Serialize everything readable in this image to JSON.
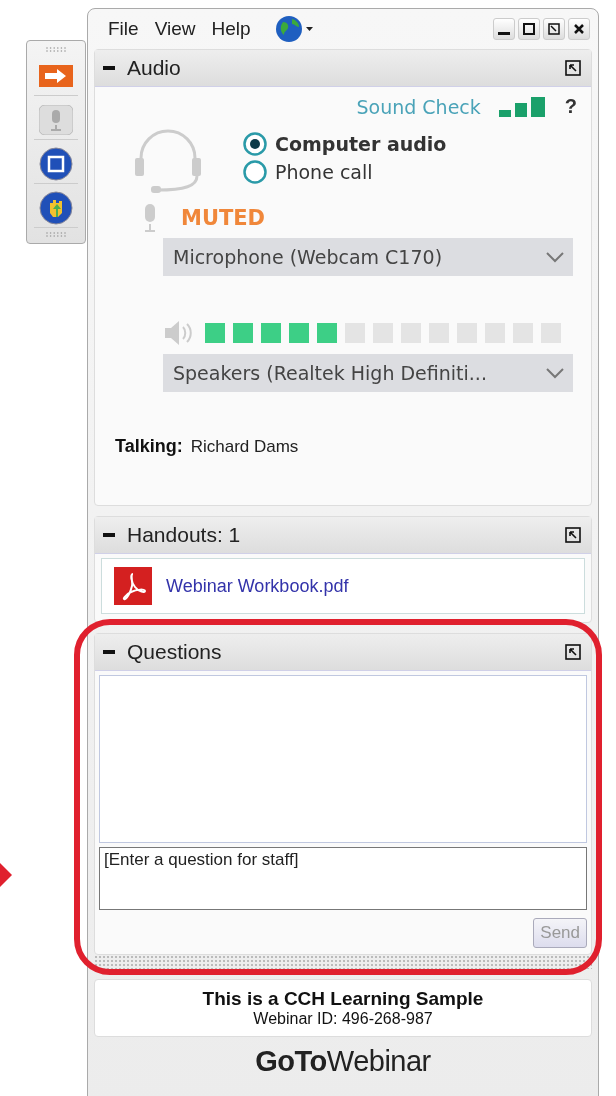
{
  "menu": [
    {
      "label": "File"
    },
    {
      "label": "View"
    },
    {
      "label": "Help"
    }
  ],
  "audio": {
    "title": "Audio",
    "sound_check": "Sound Check",
    "help": "?",
    "modes": [
      {
        "label": "Computer audio",
        "selected": true
      },
      {
        "label": "Phone call",
        "selected": false
      }
    ],
    "mic": {
      "status": "MUTED",
      "device": "Microphone (Webcam C170)"
    },
    "speaker": {
      "level": 0.385,
      "device": "Speakers (Realtek High Definiti..."
    },
    "talking": {
      "label": "Talking:",
      "name": "Richard Dams"
    }
  },
  "handouts": {
    "title": "Handouts: 1",
    "files": [
      {
        "name": "Webinar Workbook.pdf"
      }
    ]
  },
  "questions": {
    "title": "Questions",
    "placeholder": "[Enter a question for staff]",
    "send": "Send",
    "send_disabled": true
  },
  "footer": {
    "title": "This is a CCH Learning Sample",
    "webinar_id": "Webinar ID: 496-268-987",
    "logo": "**GoTo**Webinar"
  }
}
